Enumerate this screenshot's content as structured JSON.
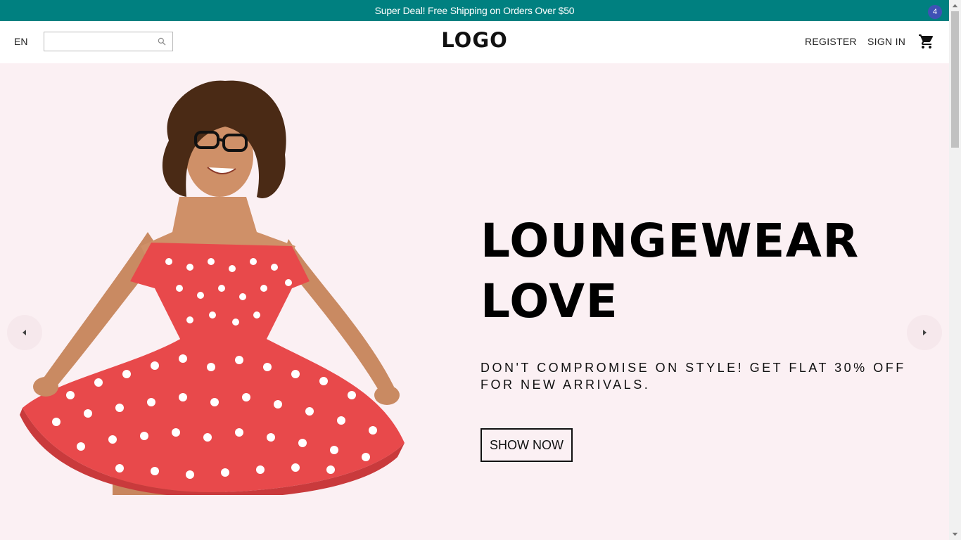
{
  "announcement": {
    "text": "Super Deal! Free Shipping on Orders Over $50"
  },
  "header": {
    "language": "EN",
    "search": {
      "value": "",
      "placeholder": ""
    },
    "logo": "LOGO",
    "links": {
      "register": "REGISTER",
      "signin": "SIGN IN"
    },
    "cart_count": "4"
  },
  "hero": {
    "headline_line1": "LOUNGEWEAR",
    "headline_line2": "LOVE",
    "subtitle": "DON'T COMPROMISE ON STYLE! GET FLAT 30% OFF FOR NEW ARRIVALS.",
    "cta_label": "SHOW NOW"
  },
  "icons": {
    "search": "search-icon",
    "cart": "shopping-cart-icon",
    "prev": "arrow-left-icon",
    "next": "arrow-right-icon"
  },
  "colors": {
    "announcement_bg": "#008080",
    "hero_bg": "#fbf0f3",
    "badge_bg": "#3f51b5",
    "dress": "#e8494b"
  }
}
